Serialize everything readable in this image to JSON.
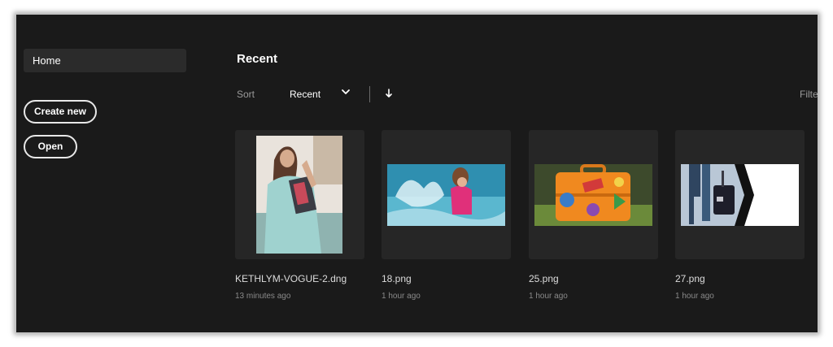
{
  "sidebar": {
    "home_label": "Home",
    "create_new_label": "Create new",
    "open_label": "Open"
  },
  "main": {
    "section_title": "Recent",
    "sort_label": "Sort",
    "sort_value": "Recent",
    "filter_label": "Filte",
    "files": [
      {
        "name": "KETHLYM-VOGUE-2.dng",
        "time": "13 minutes ago"
      },
      {
        "name": "18.png",
        "time": "1 hour ago"
      },
      {
        "name": "25.png",
        "time": "1 hour ago"
      },
      {
        "name": "27.png",
        "time": "1 hour ago"
      }
    ]
  },
  "icons": {
    "sort_dropdown": "chevron-down-icon",
    "sort_direction": "arrow-down-icon"
  },
  "colors": {
    "background": "#1a1a1a",
    "card": "#262626",
    "sidebar_selected": "#2b2b2b"
  }
}
